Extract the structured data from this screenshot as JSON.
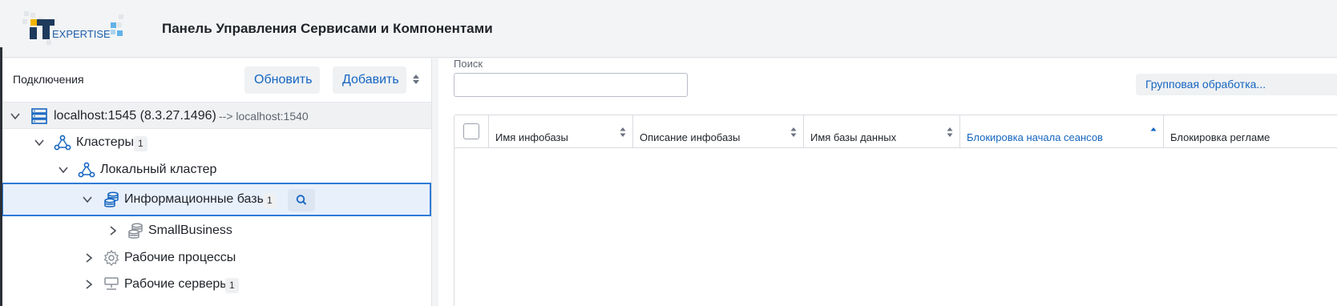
{
  "header": {
    "logo_text": "EXPERTISE",
    "logo_mark": "IT",
    "title": "Панель Управления Сервисами и Компонентами"
  },
  "left_panel": {
    "title": "Подключения",
    "refresh_label": "Обновить",
    "add_label": "Добавить",
    "tree": {
      "root": {
        "label": "localhost:1545 (8.3.27.1496)",
        "note": "--> localhost:1540",
        "icon": "server-icon"
      },
      "clusters": {
        "label": "Кластеры",
        "badge": "1",
        "icon": "cluster-icon"
      },
      "local_cluster": {
        "label": "Локальный кластер",
        "icon": "cluster-icon"
      },
      "infobases": {
        "label": "Информационные базы",
        "badge": "1",
        "icon": "database-icon"
      },
      "smallbusiness": {
        "label": "SmallBusiness",
        "icon": "database-icon"
      },
      "work_processes": {
        "label": "Рабочие процессы",
        "icon": "gear-icon"
      },
      "work_servers": {
        "label": "Рабочие серверы",
        "badge": "1",
        "icon": "server-icon"
      }
    }
  },
  "right_panel": {
    "search": {
      "label": "Поиск",
      "value": "",
      "placeholder": ""
    },
    "group_button": "Групповая обработка...",
    "columns": [
      {
        "label": "Имя инфобазы",
        "sort": "none"
      },
      {
        "label": "Описание инфобазы",
        "sort": "none"
      },
      {
        "label": "Имя базы данных",
        "sort": "none"
      },
      {
        "label": "Блокировка начала сеансов",
        "sort": "asc"
      },
      {
        "label": "Блокировка регламе",
        "sort": "none"
      }
    ],
    "rows": []
  },
  "colors": {
    "accent": "#1565c0",
    "selection_bg": "#e8f0fb",
    "selection_border": "#2f7bd6",
    "header_bg": "#f3f4f5"
  }
}
